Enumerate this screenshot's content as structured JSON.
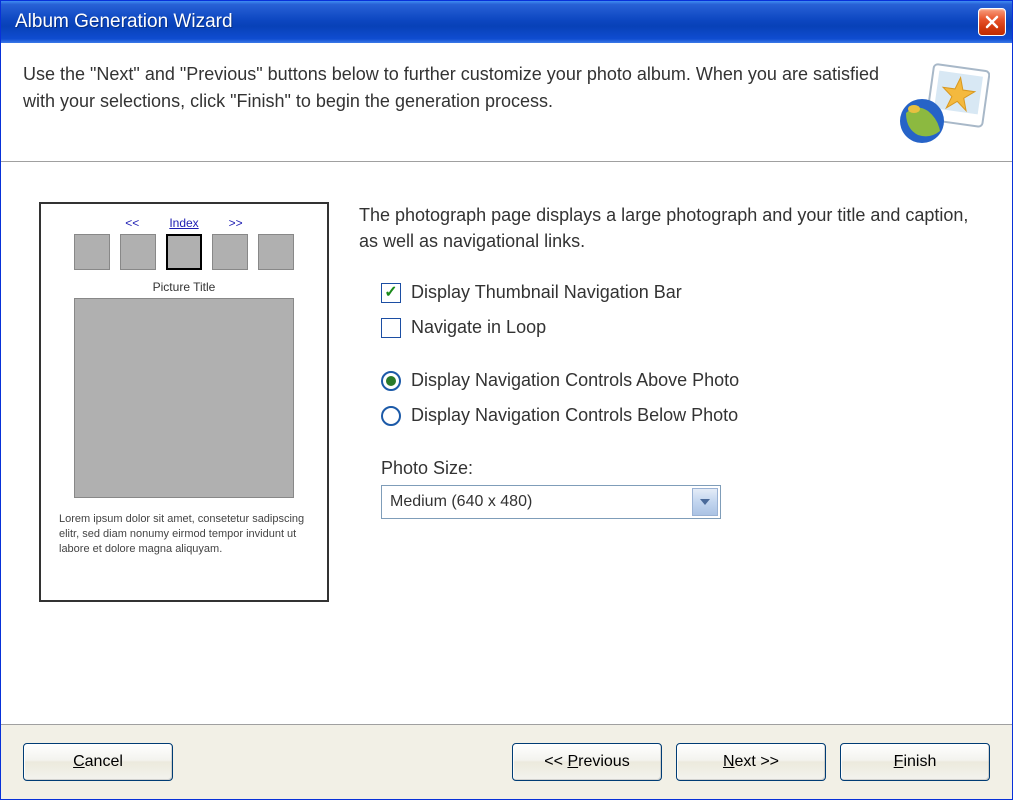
{
  "title": "Album Generation Wizard",
  "header_text": "Use the \"Next\" and \"Previous\" buttons below to further customize your photo album. When you are satisfied with your selections, click \"Finish\" to begin the generation process.",
  "preview": {
    "nav_prev": "<<",
    "nav_index": "Index",
    "nav_next": ">>",
    "picture_title": "Picture Title",
    "lorem": "Lorem ipsum dolor sit amet, consetetur sadipscing elitr, sed diam nonumy eirmod tempor invidunt ut labore et dolore magna aliquyam."
  },
  "description": "The photograph page displays a large photograph and your title and caption, as well as navigational links.",
  "options": {
    "thumbnail_nav": {
      "label": "Display Thumbnail Navigation Bar",
      "checked": true
    },
    "navigate_loop": {
      "label": "Navigate in Loop",
      "checked": false
    },
    "nav_position": {
      "above": {
        "label": "Display Navigation Controls Above Photo",
        "selected": true
      },
      "below": {
        "label": "Display Navigation Controls Below Photo",
        "selected": false
      }
    },
    "photo_size_label": "Photo Size:",
    "photo_size_value": "Medium (640 x 480)"
  },
  "buttons": {
    "cancel": "Cancel",
    "previous": "<< Previous",
    "next": "Next >>",
    "finish": "Finish"
  }
}
